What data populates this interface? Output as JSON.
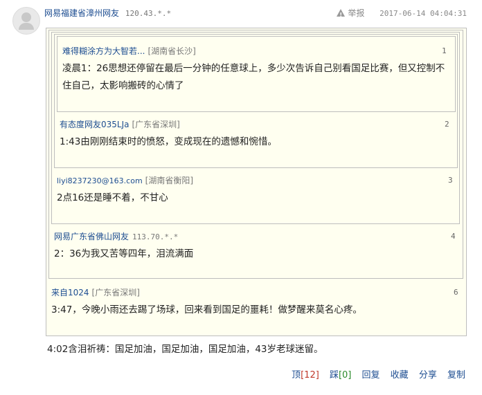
{
  "post": {
    "user": "网易福建省漳州网友",
    "ip": "120.43.*.*",
    "report_label": "举报",
    "timestamp": "2017-06-14 04:04:31",
    "text": "4:02含泪祈祷：国足加油，国足加油，国足加油，43岁老球迷留。"
  },
  "quotes": [
    {
      "user": "难得糊涂方为大智若...",
      "location": "[湖南省长沙]",
      "floor": "1",
      "text": "凌晨1：26思想还停留在最后一分钟的任意球上，多少次告诉自己别看国足比赛，但又控制不住自己，太影响搬砖的心情了"
    },
    {
      "user": "有态度网友035LJa",
      "location": "[广东省深圳]",
      "floor": "2",
      "text": "1:43由刚刚结束时的愤怒，变成现在的遗憾和惋惜。"
    },
    {
      "user": "liyi8237230@163.com",
      "location": "[湖南省衡阳]",
      "floor": "3",
      "text": "2点16还是睡不着，不甘心"
    },
    {
      "user": "网易广东省佛山网友",
      "ip": "113.70.*.*",
      "floor": "4",
      "text": "2：36为我又苦等四年，泪流满面"
    },
    {
      "user": "来自1024",
      "location": "[广东省深圳]",
      "floor": "6",
      "text": "3:47，今晚小雨还去踢了场球，回来看到国足的噩耗！做梦醒来莫名心疼。"
    }
  ],
  "actions": {
    "up_label": "顶",
    "up_count": "[12]",
    "down_label": "踩",
    "down_count": "[0]",
    "reply_label": "回复",
    "favorite_label": "收藏",
    "share_label": "分享",
    "copy_label": "复制"
  },
  "icons": {
    "avatar": "default-avatar-icon",
    "report": "warning-icon"
  },
  "colors": {
    "link": "#1d4d91",
    "box_bg": "#fffff0",
    "up_count": "#c0392b",
    "down_count": "#2a8a2a"
  }
}
